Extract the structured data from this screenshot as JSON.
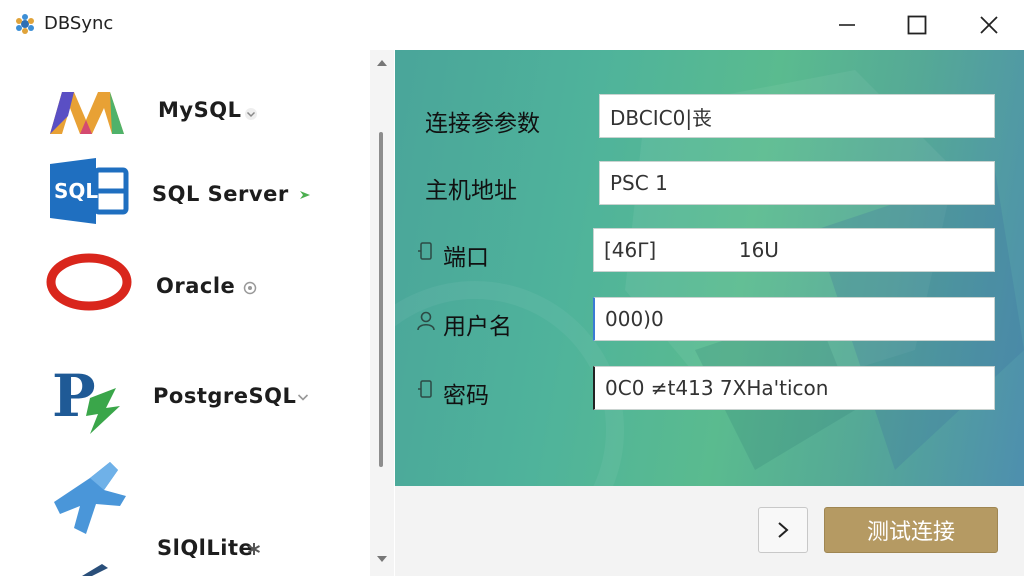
{
  "window": {
    "title": "DBSync",
    "icons": {
      "logo": "dbsync-logo-icon",
      "minimize": "minimize-icon",
      "maximize": "maximize-icon",
      "close": "close-icon"
    }
  },
  "sidebar": {
    "items": [
      {
        "label": "MySQL",
        "icon": "mysql-logo-icon",
        "badge": "chevron-down-icon"
      },
      {
        "label": "SQL  Server",
        "icon": "sql-server-logo-icon",
        "badge": "arrow-icon"
      },
      {
        "label": "Oracle",
        "icon": "oracle-logo-icon",
        "badge": "circle-icon"
      },
      {
        "label": "PostgreSQL",
        "icon": "postgresql-logo-icon",
        "badge": "chevron-down-icon"
      },
      {
        "label": "SlQlLite",
        "icon": "sqlite-logo-icon",
        "badge": "asterisk-icon"
      },
      {
        "label": "",
        "icon": "partial-logo-icon",
        "badge": ""
      }
    ]
  },
  "form": {
    "fields": [
      {
        "label": "连接参参数",
        "value": "DBCIC0|丧",
        "icon": ""
      },
      {
        "label": "主机地址",
        "value": "PSC 1",
        "icon": ""
      },
      {
        "label": "端口",
        "value": "[46ᒥ]             16U",
        "icon": "port-icon"
      },
      {
        "label": "用户名",
        "value": "000)0",
        "icon": "user-icon"
      },
      {
        "label": "密码",
        "value": "0C0 ≠t413 7XHa'ticon",
        "icon": "lock-icon"
      }
    ]
  },
  "footer": {
    "next_icon": "chevron-right-icon",
    "test_button": "测试连接"
  },
  "colors": {
    "panel_gradient_start": "#4aa59a",
    "panel_gradient_end": "#4e8fae",
    "test_button": "#b59a63"
  }
}
